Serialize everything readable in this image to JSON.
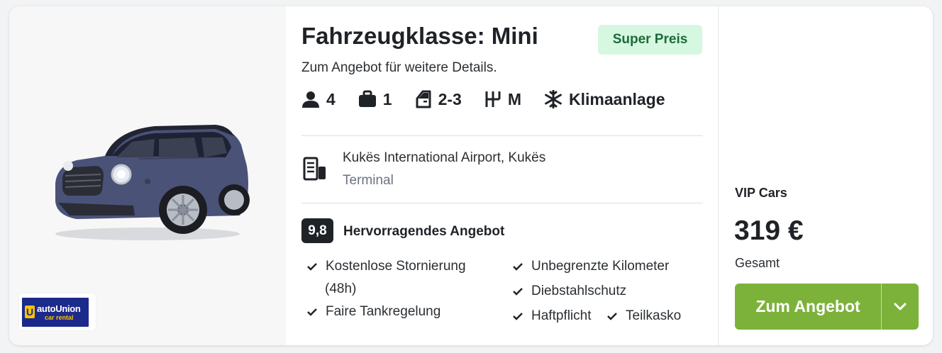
{
  "offer": {
    "title": "Fahrzeugklasse: Mini",
    "badge": "Super Preis",
    "subtitle": "Zum Angebot für weitere Details.",
    "specs": {
      "seats": "4",
      "bags": "1",
      "doors": "2-3",
      "transmission": "M",
      "ac": "Klimaanlage"
    },
    "location": {
      "name": "Kukës International Airport, Kukës",
      "type": "Terminal"
    },
    "rating": {
      "score": "9,8",
      "label": "Hervorragendes Angebot"
    },
    "features": {
      "cancel_line1": "Kostenlose Stornierung",
      "cancel_line2": "(48h)",
      "fuel": "Faire Tankregelung",
      "mileage": "Unbegrenzte Kilometer",
      "theft": "Diebstahlschutz",
      "liability": "Haftpflicht",
      "collision": "Teilkasko"
    }
  },
  "supplier_logo": {
    "title": "autoUnion",
    "subtitle": "car rental",
    "colors": {
      "background": "#1c2a8c",
      "accent": "#f5c400"
    }
  },
  "pricing": {
    "vendor": "VIP Cars",
    "price": "319 €",
    "price_label": "Gesamt",
    "cta_label": "Zum Angebot"
  },
  "colors": {
    "badge_bg": "#d6f7e0",
    "badge_text": "#1c6b3a",
    "cta": "#7db23a",
    "score_bg": "#1f2328",
    "car_body": "#4a5278"
  }
}
